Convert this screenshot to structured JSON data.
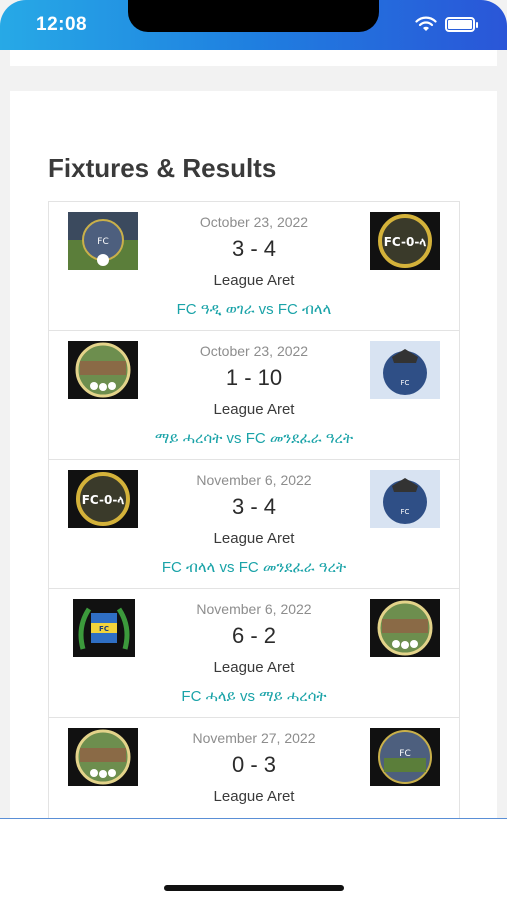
{
  "status_bar": {
    "time": "12:08"
  },
  "section": {
    "title": "Fixtures & Results"
  },
  "fixtures": [
    {
      "date": "October 23, 2022",
      "score": "3 - 4",
      "league": "League Aret",
      "teams": "FC ዓዲ ወገራ vs FC ብላላ",
      "home_logo": "team-crest-photo",
      "away_logo": "fc-0-la-gold-badge"
    },
    {
      "date": "October 23, 2022",
      "score": "1 - 10",
      "league": "League Aret",
      "teams": "ማይ ሓረሳት vs FC መንደፈራ ዓረት",
      "home_logo": "football-pitch-badge",
      "away_logo": "fc-mendefera-crest"
    },
    {
      "date": "November 6, 2022",
      "score": "3 - 4",
      "league": "League Aret",
      "teams": "FC ብላላ vs FC መንደፈራ ዓረት",
      "home_logo": "fc-0-la-gold-badge",
      "away_logo": "fc-mendefera-crest"
    },
    {
      "date": "November 6, 2022",
      "score": "6 - 2",
      "league": "League Aret",
      "teams": "FC ሓላይ vs ማይ ሓረሳት",
      "home_logo": "fc-halay-laurel-badge",
      "away_logo": "football-pitch-badge"
    },
    {
      "date": "November 27, 2022",
      "score": "0 - 3",
      "league": "League Aret",
      "teams": "",
      "home_logo": "football-pitch-badge",
      "away_logo": "team-crest-photo"
    }
  ],
  "colors": {
    "accent": "#1aa3a8",
    "status_gradient_start": "#27a9e6",
    "status_gradient_end": "#2a56d8"
  }
}
